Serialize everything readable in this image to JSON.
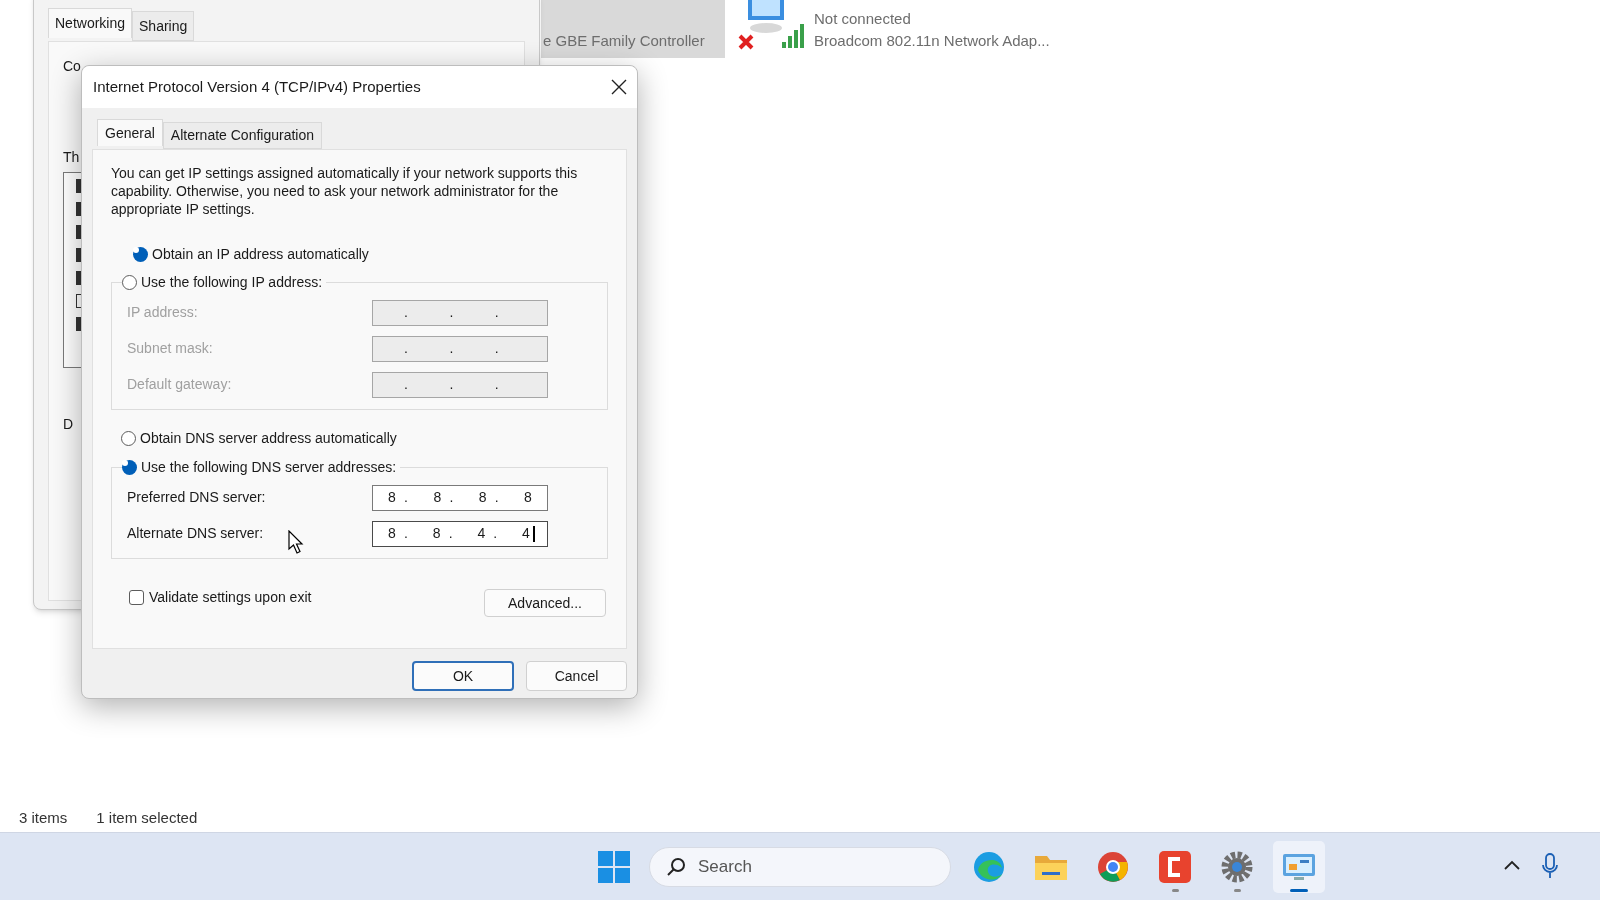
{
  "background_window": {
    "tabs": [
      {
        "label": "Networking",
        "selected": true
      },
      {
        "label": "Sharing",
        "selected": false
      }
    ],
    "connect_label": "Co",
    "components_label": "Th",
    "description_label": "D",
    "components": [
      {
        "checked": true
      },
      {
        "checked": true
      },
      {
        "checked": true
      },
      {
        "checked": true
      },
      {
        "checked": true
      },
      {
        "checked": false
      },
      {
        "checked": true
      }
    ]
  },
  "explorer_items": [
    {
      "kind": "ethernet",
      "selected": true,
      "lines": [
        "e GBE Family Controller"
      ]
    },
    {
      "kind": "wifi",
      "selected": false,
      "lines": [
        "Not connected",
        "Broadcom 802.11n Network Adap..."
      ]
    }
  ],
  "dialog": {
    "title": "Internet Protocol Version 4 (TCP/IPv4) Properties",
    "tabs": [
      {
        "label": "General",
        "selected": true
      },
      {
        "label": "Alternate Configuration",
        "selected": false
      }
    ],
    "intro": "You can get IP settings assigned automatically if your network supports this capability. Otherwise, you need to ask your network administrator for the appropriate IP settings.",
    "ip_auto": {
      "label": "Obtain an IP address automatically",
      "selected": true
    },
    "ip_manual": {
      "label": "Use the following IP address:",
      "selected": false
    },
    "ip_fields": [
      {
        "label": "IP address:",
        "disabled": true,
        "separators": [
          ".",
          ".",
          "."
        ]
      },
      {
        "label": "Subnet mask:",
        "disabled": true,
        "separators": [
          ".",
          ".",
          "."
        ]
      },
      {
        "label": "Default gateway:",
        "disabled": true,
        "separators": [
          ".",
          ".",
          "."
        ]
      }
    ],
    "dns_auto": {
      "label": "Obtain DNS server address automatically",
      "selected": false
    },
    "dns_manual": {
      "label": "Use the following DNS server addresses:",
      "selected": true
    },
    "dns_fields": [
      {
        "label": "Preferred DNS server:",
        "disabled": false,
        "focused": false,
        "octets": [
          "8",
          "8",
          "8",
          "8"
        ],
        "separators": [
          ".",
          ".",
          "."
        ]
      },
      {
        "label": "Alternate DNS server:",
        "disabled": false,
        "focused": true,
        "octets": [
          "8",
          "8",
          "4",
          "4"
        ],
        "separators": [
          ".",
          ".",
          "."
        ]
      }
    ],
    "validate": {
      "label": "Validate settings upon exit",
      "checked": false
    },
    "advanced_button": "Advanced...",
    "ok_button": "OK",
    "cancel_button": "Cancel"
  },
  "status_bar": {
    "count": "3 items",
    "selection": "1 item selected"
  },
  "taskbar": {
    "search_placeholder": "Search",
    "apps": [
      {
        "kind": "edge",
        "running": false,
        "active": false
      },
      {
        "kind": "folder",
        "running": false,
        "active": false
      },
      {
        "kind": "chrome",
        "running": false,
        "active": false
      },
      {
        "kind": "camtasia",
        "running": true,
        "active": false
      },
      {
        "kind": "settings",
        "running": true,
        "active": false
      },
      {
        "kind": "control-panel",
        "running": true,
        "active": true
      }
    ]
  }
}
